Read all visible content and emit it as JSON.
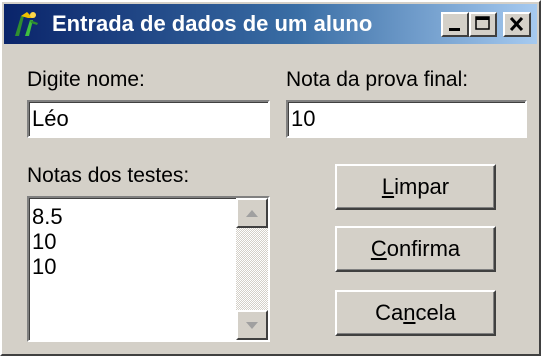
{
  "window": {
    "title": "Entrada de dados de um aluno",
    "icon": "app-figure-icon"
  },
  "titlebar_buttons": {
    "minimize": "minimize-icon",
    "maximize": "maximize-icon",
    "close": "close-icon"
  },
  "form": {
    "name_label": "Digite nome:",
    "name_value": "Léo",
    "final_label": "Nota da prova final:",
    "final_value": "10",
    "tests_label": "Notas dos testes:",
    "tests": [
      "8.5",
      "10",
      "10"
    ]
  },
  "buttons": {
    "limpar": {
      "pre": "",
      "key": "L",
      "post": "impar"
    },
    "confirma": {
      "pre": "",
      "key": "C",
      "post": "onfirma"
    },
    "cancela": {
      "pre": "Ca",
      "key": "n",
      "post": "cela"
    }
  },
  "colors": {
    "face": "#d4d0c8",
    "title_start": "#0a246a",
    "title_end": "#a6caf0"
  }
}
